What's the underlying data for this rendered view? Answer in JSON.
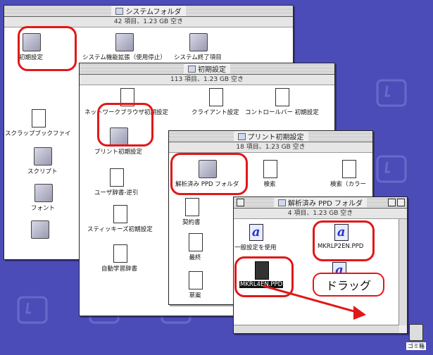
{
  "windows": {
    "system_folder": {
      "title": "システムフォルダ",
      "info": "42 項目、1.23 GB 空き",
      "items": [
        "初期設定",
        "システム機能拡張（使用停止）",
        "システム終了項目",
        "スクラップブックファイ",
        "スクリプト",
        "フォント"
      ]
    },
    "preferences": {
      "title": "初期設定",
      "info": "113 項目、1.23 GB 空き",
      "items": [
        "ネットワークブラウザ初期設定",
        "クライアント設定",
        "コントロールバー 初期設定",
        "プリント初期設定",
        "ユーザ辞書-逆引",
        "スティッキーズ初期設定",
        "自動学習辞書"
      ]
    },
    "print_prefs": {
      "title": "プリント初期設定",
      "info": "18 項目、1.23 GB 空き",
      "items": [
        "解析済み PPD フォルダ",
        "検索",
        "検索（カラー",
        "契約書",
        "最終",
        "草案"
      ]
    },
    "ppd_folder": {
      "title": "解析済み PPD フォルダ",
      "info": "4 項目、1.23 GB 空き",
      "items": [
        "一般設定を使用",
        "MKRLP2EN.PPD",
        "MKRL4EN.PPD"
      ]
    }
  },
  "annotation": {
    "drag_label": "ドラッグ"
  },
  "trash": {
    "label": "ゴミ箱"
  },
  "colors": {
    "desktop": "#4c4cb8",
    "highlight": "#e01818",
    "arrow": "#e01818"
  }
}
